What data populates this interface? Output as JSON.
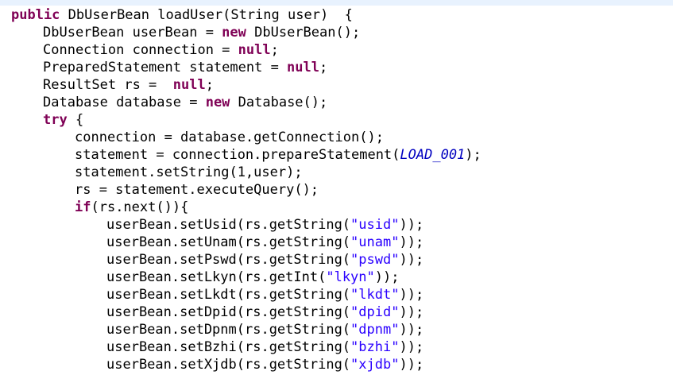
{
  "editor": {
    "lines": [
      {
        "indent": 0,
        "tokens": [
          {
            "t": "kw",
            "v": "public"
          },
          {
            "t": "plain",
            "v": " DbUserBean loadUser(String user)  {"
          }
        ]
      },
      {
        "indent": 1,
        "tokens": [
          {
            "t": "plain",
            "v": "DbUserBean userBean = "
          },
          {
            "t": "kw",
            "v": "new"
          },
          {
            "t": "plain",
            "v": " DbUserBean();"
          }
        ]
      },
      {
        "indent": 1,
        "tokens": [
          {
            "t": "plain",
            "v": "Connection connection = "
          },
          {
            "t": "kw",
            "v": "null"
          },
          {
            "t": "plain",
            "v": ";"
          }
        ]
      },
      {
        "indent": 1,
        "tokens": [
          {
            "t": "plain",
            "v": "PreparedStatement statement = "
          },
          {
            "t": "kw",
            "v": "null"
          },
          {
            "t": "plain",
            "v": ";"
          }
        ]
      },
      {
        "indent": 1,
        "tokens": [
          {
            "t": "plain",
            "v": "ResultSet rs =  "
          },
          {
            "t": "kw",
            "v": "null"
          },
          {
            "t": "plain",
            "v": ";"
          }
        ]
      },
      {
        "indent": 1,
        "tokens": [
          {
            "t": "plain",
            "v": "Database database = "
          },
          {
            "t": "kw",
            "v": "new"
          },
          {
            "t": "plain",
            "v": " Database();"
          }
        ]
      },
      {
        "indent": 1,
        "tokens": [
          {
            "t": "kw",
            "v": "try"
          },
          {
            "t": "plain",
            "v": " {"
          }
        ]
      },
      {
        "indent": 2,
        "tokens": [
          {
            "t": "plain",
            "v": "connection = database.getConnection();"
          }
        ]
      },
      {
        "indent": 2,
        "tokens": [
          {
            "t": "plain",
            "v": "statement = connection.prepareStatement("
          },
          {
            "t": "const",
            "v": "LOAD_001"
          },
          {
            "t": "plain",
            "v": ");"
          }
        ]
      },
      {
        "indent": 2,
        "tokens": [
          {
            "t": "plain",
            "v": "statement.setString(1,user);"
          }
        ]
      },
      {
        "indent": 2,
        "tokens": [
          {
            "t": "plain",
            "v": "rs = statement.executeQuery();"
          }
        ]
      },
      {
        "indent": 2,
        "tokens": [
          {
            "t": "kw",
            "v": "if"
          },
          {
            "t": "plain",
            "v": "(rs.next()){"
          }
        ]
      },
      {
        "indent": 3,
        "tokens": [
          {
            "t": "plain",
            "v": "userBean.setUsid(rs.getString("
          },
          {
            "t": "str",
            "v": "\"usid\""
          },
          {
            "t": "plain",
            "v": "));"
          }
        ]
      },
      {
        "indent": 3,
        "tokens": [
          {
            "t": "plain",
            "v": "userBean.setUnam(rs.getString("
          },
          {
            "t": "str",
            "v": "\"unam\""
          },
          {
            "t": "plain",
            "v": "));"
          }
        ]
      },
      {
        "indent": 3,
        "tokens": [
          {
            "t": "plain",
            "v": "userBean.setPswd(rs.getString("
          },
          {
            "t": "str",
            "v": "\"pswd\""
          },
          {
            "t": "plain",
            "v": "));"
          }
        ]
      },
      {
        "indent": 3,
        "tokens": [
          {
            "t": "plain",
            "v": "userBean.setLkyn(rs.getInt("
          },
          {
            "t": "str",
            "v": "\"lkyn\""
          },
          {
            "t": "plain",
            "v": "));"
          }
        ]
      },
      {
        "indent": 3,
        "tokens": [
          {
            "t": "plain",
            "v": "userBean.setLkdt(rs.getString("
          },
          {
            "t": "str",
            "v": "\"lkdt\""
          },
          {
            "t": "plain",
            "v": "));"
          }
        ]
      },
      {
        "indent": 3,
        "tokens": [
          {
            "t": "plain",
            "v": "userBean.setDpid(rs.getString("
          },
          {
            "t": "str",
            "v": "\"dpid\""
          },
          {
            "t": "plain",
            "v": "));"
          }
        ]
      },
      {
        "indent": 3,
        "tokens": [
          {
            "t": "plain",
            "v": "userBean.setDpnm(rs.getString("
          },
          {
            "t": "str",
            "v": "\"dpnm\""
          },
          {
            "t": "plain",
            "v": "));"
          }
        ]
      },
      {
        "indent": 3,
        "tokens": [
          {
            "t": "plain",
            "v": "userBean.setBzhi(rs.getString("
          },
          {
            "t": "str",
            "v": "\"bzhi\""
          },
          {
            "t": "plain",
            "v": "));"
          }
        ]
      },
      {
        "indent": 3,
        "tokens": [
          {
            "t": "plain",
            "v": "userBean.setXjdb(rs.getString("
          },
          {
            "t": "str",
            "v": "\"xjdb\""
          },
          {
            "t": "plain",
            "v": "));"
          }
        ]
      }
    ]
  },
  "colors": {
    "keyword": "#7f0055",
    "string": "#2a00ff",
    "constant": "#0000c0",
    "text": "#000000",
    "background": "#ffffff",
    "highlight_strip": "#e8f2fe"
  }
}
